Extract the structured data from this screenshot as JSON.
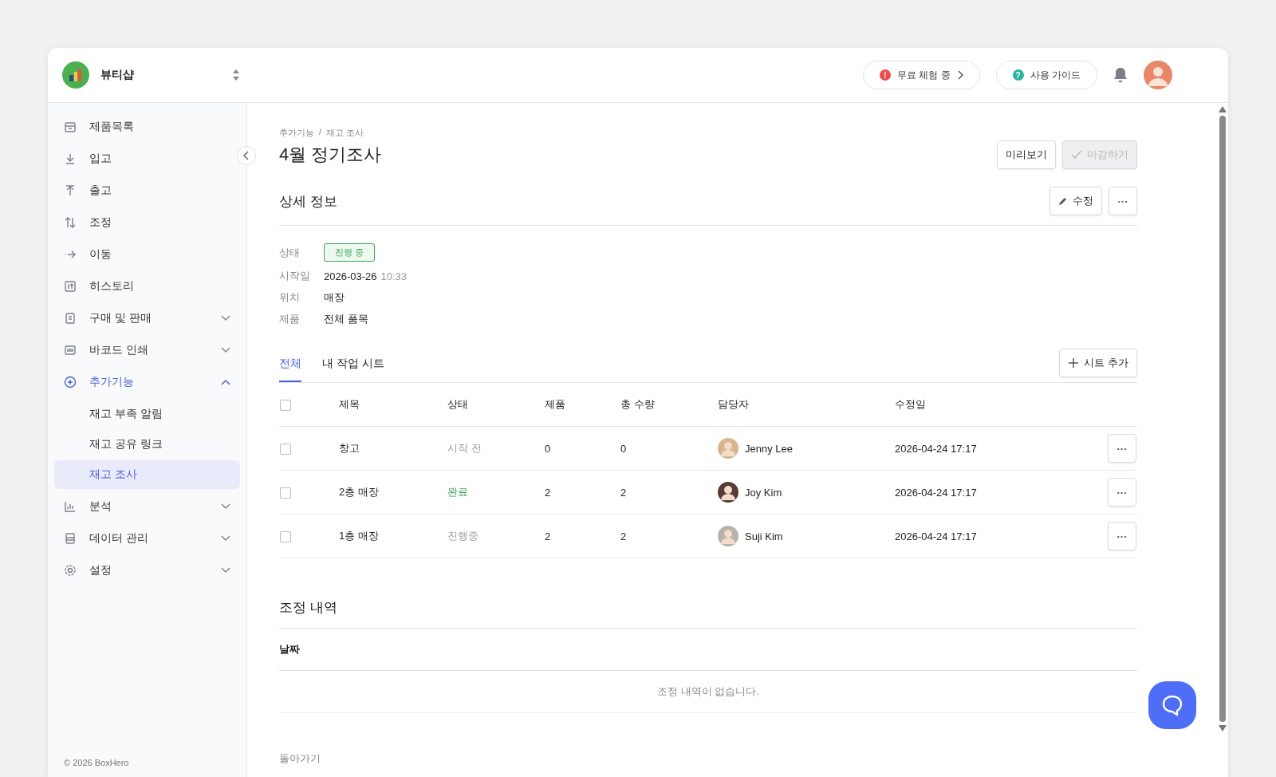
{
  "shop": {
    "name": "뷰티샵"
  },
  "header": {
    "trial": "무료 체험 중",
    "trial_badge": "!",
    "guide": "사용 가이드",
    "guide_badge": "?"
  },
  "sidebar": {
    "items": [
      {
        "kind": "item",
        "label": "제품목록"
      },
      {
        "kind": "item",
        "label": "입고"
      },
      {
        "kind": "item",
        "label": "출고"
      },
      {
        "kind": "item",
        "label": "조정"
      },
      {
        "kind": "item",
        "label": "이동"
      },
      {
        "kind": "item",
        "label": "히스토리"
      },
      {
        "kind": "group",
        "label": "구매 및 판매",
        "expanded": false,
        "selected": false
      },
      {
        "kind": "group",
        "label": "바코드 인쇄",
        "expanded": false,
        "selected": false
      },
      {
        "kind": "group",
        "label": "추가기능",
        "expanded": true,
        "selected": true,
        "children": [
          {
            "label": "재고 부족 알림",
            "selected": false
          },
          {
            "label": "재고 공유 링크",
            "selected": false
          },
          {
            "label": "재고 조사",
            "selected": true
          }
        ]
      },
      {
        "kind": "group",
        "label": "분석",
        "expanded": false,
        "selected": false
      },
      {
        "kind": "group",
        "label": "데이터 관리",
        "expanded": false,
        "selected": false
      },
      {
        "kind": "group",
        "label": "설정",
        "expanded": false,
        "selected": false
      }
    ],
    "footer": "© 2026 BoxHero"
  },
  "breadcrumb": [
    "추가기능",
    "재고 조사"
  ],
  "breadcrumb_separator": "/",
  "title": "4월 정기조사",
  "actions": [
    {
      "label": "미리보기",
      "disabled": false
    },
    {
      "label": "마감하기",
      "disabled": true
    }
  ],
  "details": {
    "title": "상세 정보",
    "edit": "수정",
    "more": "···",
    "fields": [
      {
        "kind": "badge",
        "label": "상태",
        "value": "진행 중",
        "color": "#3aa55b"
      },
      {
        "kind": "datetime",
        "label": "시작일",
        "value": "2026-03-26",
        "time": "10:33"
      },
      {
        "kind": "text",
        "label": "위치",
        "value": "매장"
      },
      {
        "kind": "text",
        "label": "제품",
        "value": "전체 품목"
      }
    ]
  },
  "tabs": [
    {
      "label": "전체",
      "selected": true
    },
    {
      "label": "내 작업 시트",
      "selected": false
    }
  ],
  "add_sheet": "시트 추가",
  "table": {
    "all_checked": false,
    "columns": [
      "제목",
      "상태",
      "제품",
      "총 수량",
      "담당자",
      "수정일"
    ],
    "rows": [
      {
        "checked": false,
        "title": "창고",
        "status": "시작 전",
        "color": "#9a9da3",
        "products": "0",
        "quantity": "0",
        "assignee": "Jenny Lee",
        "modified": "2026-04-24 17:17",
        "more": "···"
      },
      {
        "checked": false,
        "title": "2층 매장",
        "status": "완료",
        "color": "#2fa24a",
        "products": "2",
        "quantity": "2",
        "assignee": "Joy Kim",
        "modified": "2026-04-24 17:17",
        "more": "···"
      },
      {
        "checked": false,
        "title": "1층 매장",
        "status": "진행중",
        "color": "#9a9da3",
        "products": "2",
        "quantity": "2",
        "assignee": "Suji Kim",
        "modified": "2026-04-24 17:17",
        "more": "···"
      }
    ]
  },
  "adjustments": {
    "title": "조정 내역",
    "column": "날짜",
    "empty": "조정 내역이 없습니다."
  },
  "back": "돌아가기"
}
